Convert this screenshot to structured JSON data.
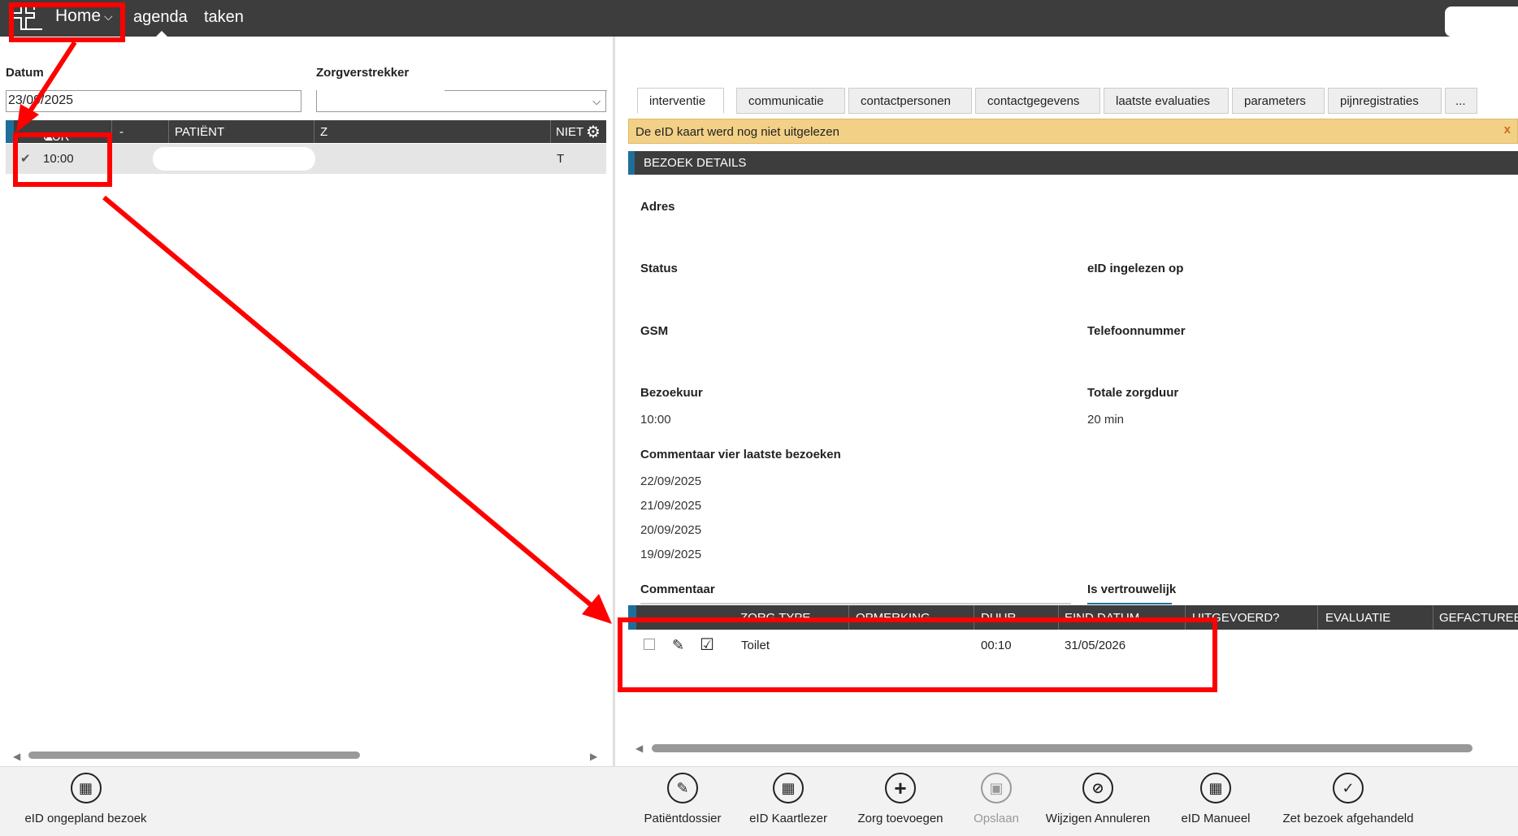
{
  "topnav": {
    "home_label": "Home",
    "agenda_label": "agenda",
    "taken_label": "taken"
  },
  "left": {
    "datum_label": "Datum",
    "zorgverstrekker_label": "Zorgverstrekker",
    "date_value": "23/09/2025",
    "columns": [
      "UUR",
      "-",
      "PATIËNT",
      "Z",
      "NIET"
    ],
    "row": {
      "time": "10:00",
      "t": "T"
    }
  },
  "tabs": [
    "interventie",
    "communicatie",
    "contactpersonen",
    "contactgegevens",
    "laatste evaluaties",
    "parameters",
    "pijnregistraties",
    "..."
  ],
  "alert": {
    "text": "De eID kaart werd nog niet uitgelezen",
    "close": "x"
  },
  "section_title": "BEZOEK DETAILS",
  "details": {
    "adres_label": "Adres",
    "status_label": "Status",
    "eid_label": "eID ingelezen op",
    "gsm_label": "GSM",
    "telefoon_label": "Telefoonnummer",
    "bezoekuur_label": "Bezoekuur",
    "bezoekuur_value": "10:00",
    "zorgduur_label": "Totale zorgduur",
    "zorgduur_value": "20 min",
    "commentaar_vier_label": "Commentaar vier laatste bezoeken",
    "dates": [
      "22/09/2025",
      "21/09/2025",
      "20/09/2025",
      "19/09/2025"
    ],
    "commentaar_label": "Commentaar",
    "vertrouwelijk_label": "Is vertrouwelijk"
  },
  "care_table": {
    "columns": [
      "ZORG TYPE",
      "OPMERKING",
      "DUUR",
      "EIND DATUM",
      "UITGEVOERD?",
      "EVALUATIE",
      "GEFACTUREE"
    ],
    "row": {
      "type": "Toilet",
      "duur": "00:10",
      "eind": "31/05/2026"
    }
  },
  "bottom_buttons": [
    {
      "label": "eID ongepland bezoek",
      "icon": "id-card-icon"
    },
    {
      "label": "Patiëntdossier",
      "icon": "patient-file-icon"
    },
    {
      "label": "eID Kaartlezer",
      "icon": "id-card-reader-icon"
    },
    {
      "label": "Zorg toevoegen",
      "icon": "plus-icon"
    },
    {
      "label": "Opslaan",
      "icon": "save-icon"
    },
    {
      "label": "Wijzigen Annuleren",
      "icon": "cancel-edit-icon"
    },
    {
      "label": "eID Manueel",
      "icon": "id-card-manual-icon"
    },
    {
      "label": "Zet bezoek afgehandeld",
      "icon": "visit-done-icon"
    }
  ],
  "colors": {
    "topbar": "#3d3d3d",
    "accent": "#1e6e9a",
    "alert": "#f2d187",
    "annotation": "#ff0000"
  }
}
